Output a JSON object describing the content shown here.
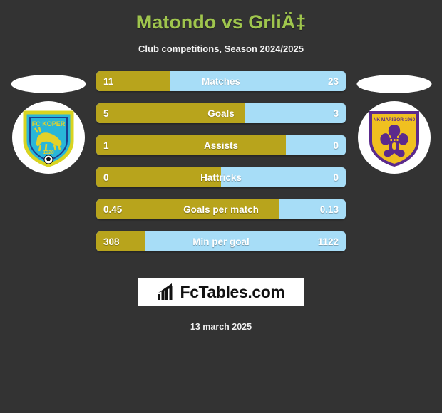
{
  "header": {
    "title": "Matondo vs GrliÄ‡",
    "subtitle": "Club competitions, Season 2024/2025"
  },
  "teams": {
    "home": {
      "crest_name": "fc-koper-crest",
      "crest_text": "FC KOPER",
      "crest_year": "1920",
      "colors": {
        "shield": "#29b6d8",
        "accent": "#d9d420",
        "figure": "#e3d12a"
      }
    },
    "away": {
      "crest_name": "nk-maribor-crest",
      "crest_text": "NK MARIBOR 1960",
      "colors": {
        "shield": "#f0c020",
        "accent": "#5b2a8c",
        "figure": "#5b2a8c"
      }
    }
  },
  "colors": {
    "background": "#333333",
    "title": "#9fc54d",
    "home_bar": "#b8a41c",
    "away_bar": "#a7ddf7",
    "text": "#ffffff"
  },
  "stats": [
    {
      "label": "Matches",
      "home": "11",
      "away": "23",
      "home_pct": 29.5
    },
    {
      "label": "Goals",
      "home": "5",
      "away": "3",
      "home_pct": 59.5
    },
    {
      "label": "Assists",
      "home": "1",
      "away": "0",
      "home_pct": 76.0
    },
    {
      "label": "Hattricks",
      "home": "0",
      "away": "0",
      "home_pct": 50.0
    },
    {
      "label": "Goals per match",
      "home": "0.45",
      "away": "0.13",
      "home_pct": 73.0
    },
    {
      "label": "Min per goal",
      "home": "308",
      "away": "1122",
      "home_pct": 19.4
    }
  ],
  "footer": {
    "logo_text": "FcTables.com",
    "logo_icon": "bar-chart-icon",
    "date": "13 march 2025"
  }
}
